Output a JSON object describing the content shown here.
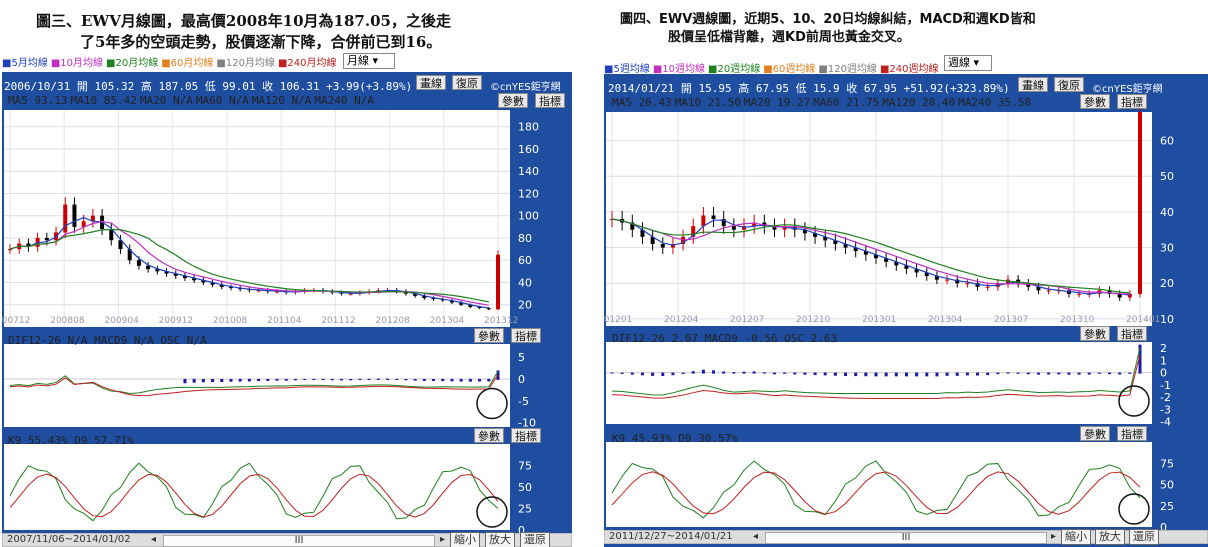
{
  "left": {
    "caption_line1": "圖三、EWV月線圖，最高價2008年10月為187.05，之後走",
    "caption_line2": "了5年多的空頭走勢，股價逐漸下降，合併前已到16。",
    "legend": [
      {
        "label": "5月均線",
        "color": "#2040c0"
      },
      {
        "label": "10月均線",
        "color": "#c030c0"
      },
      {
        "label": "20月均線",
        "color": "#208020"
      },
      {
        "label": "60月均線",
        "color": "#e08020"
      },
      {
        "label": "120月均線",
        "color": "#808080"
      },
      {
        "label": "240月均線",
        "color": "#c02020"
      }
    ],
    "period_select": "月線",
    "ohlc": "2006/10/31 開 105.32 高 187.05 低 99.01 收 106.31 +3.99(+3.89%)",
    "draw_btn": "畫線",
    "restore_btn": "復原",
    "brand": "©cnYES鉅亨網",
    "ma_readout": [
      "MA5 93.13",
      "MA10 85.42",
      "MA20 N/A",
      "MA60 N/A",
      "MA120 N/A",
      "MA240 N/A"
    ],
    "param_btn": "參數",
    "indicator_btn": "指標",
    "macd_readout": "DIF12-26 N/A  MACD9 N/A  OSC N/A",
    "kd_readout": "K9 55.43%  D9 57.71%",
    "date_range": "2007/11/06~2014/01/02",
    "zoom_out": "縮小",
    "zoom_in": "放大",
    "reset": "還原"
  },
  "right": {
    "caption_line1": "圖四、EWV週線圖，近期5、10、20日均線糾結，MACD和週KD皆和",
    "caption_line2": "股價呈低檔背離，週KD前周也黃金交叉。",
    "legend": [
      {
        "label": "5週均線",
        "color": "#2040c0"
      },
      {
        "label": "10週均線",
        "color": "#c030c0"
      },
      {
        "label": "20週均線",
        "color": "#208020"
      },
      {
        "label": "60週均線",
        "color": "#e08020"
      },
      {
        "label": "120週均線",
        "color": "#808080"
      },
      {
        "label": "240週均線",
        "color": "#c02020"
      }
    ],
    "period_select": "週線",
    "ohlc": "2014/01/21 開 15.95 高 67.95 低 15.9 收 67.95 +51.92(+323.89%)",
    "draw_btn": "畫線",
    "restore_btn": "復原",
    "brand": "©cnYES鉅亨網",
    "ma_readout": [
      "MA5 26.43",
      "MA10 21.50",
      "MA20 19.27",
      "MA60 21.75",
      "MA120 28.40",
      "MA240 35.58"
    ],
    "param_btn": "參數",
    "indicator_btn": "指標",
    "macd_readout": "DIF12-26 2.07  MACD9 -0.56  OSC 2.63",
    "kd_readout": "K9 45.93%  D9 30.57%",
    "date_range": "2011/12/27~2014/01/21",
    "zoom_out": "縮小",
    "zoom_in": "放大",
    "reset": "還原"
  },
  "chart_data": [
    {
      "type": "line",
      "name": "EWV monthly price",
      "x_ticks": [
        "200712",
        "200808",
        "200904",
        "200912",
        "201008",
        "201104",
        "201112",
        "201208",
        "201304",
        "201312"
      ],
      "y_ticks": [
        20,
        40,
        60,
        80,
        100,
        120,
        140,
        160,
        180
      ],
      "ylim": [
        0,
        195
      ],
      "close": [
        70,
        75,
        72,
        80,
        78,
        85,
        110,
        90,
        95,
        100,
        88,
        78,
        70,
        60,
        55,
        52,
        50,
        48,
        46,
        44,
        42,
        40,
        38,
        36,
        35,
        34,
        33,
        33,
        32,
        32,
        31,
        32,
        33,
        33,
        32,
        31,
        30,
        30,
        31,
        32,
        33,
        33,
        32,
        30,
        28,
        26,
        25,
        24,
        22,
        20,
        18,
        17,
        16,
        65
      ]
    },
    {
      "type": "bar",
      "name": "EWV monthly MACD",
      "y_ticks": [
        5,
        0,
        -5,
        -10
      ],
      "ylim": [
        -11,
        8
      ]
    },
    {
      "type": "line",
      "name": "EWV monthly KD",
      "y_ticks": [
        75,
        50,
        25,
        0
      ],
      "ylim": [
        0,
        100
      ]
    },
    {
      "type": "line",
      "name": "EWV weekly price",
      "x_ticks": [
        "201201",
        "201204",
        "201207",
        "201210",
        "201301",
        "201304",
        "201307",
        "201310",
        "201401"
      ],
      "y_ticks": [
        10,
        20,
        30,
        40,
        50,
        60
      ],
      "ylim": [
        8,
        68
      ],
      "close": [
        38,
        37,
        35,
        33,
        31,
        30,
        31,
        33,
        36,
        39,
        38,
        36,
        35,
        36,
        37,
        36,
        35,
        36,
        35,
        34,
        33,
        32,
        31,
        30,
        29,
        28,
        27,
        26,
        25,
        24,
        23,
        22,
        21,
        21,
        20,
        20,
        19,
        19,
        20,
        21,
        20,
        19,
        18,
        18,
        18,
        17,
        17,
        17,
        18,
        17,
        16,
        17,
        68
      ]
    },
    {
      "type": "bar",
      "name": "EWV weekly MACD",
      "y_ticks": [
        2,
        1,
        0,
        -1,
        -2,
        -3,
        -4
      ],
      "ylim": [
        -4.2,
        2.5
      ]
    },
    {
      "type": "line",
      "name": "EWV weekly KD",
      "y_ticks": [
        75,
        50,
        25,
        0
      ],
      "ylim": [
        0,
        100
      ]
    }
  ]
}
